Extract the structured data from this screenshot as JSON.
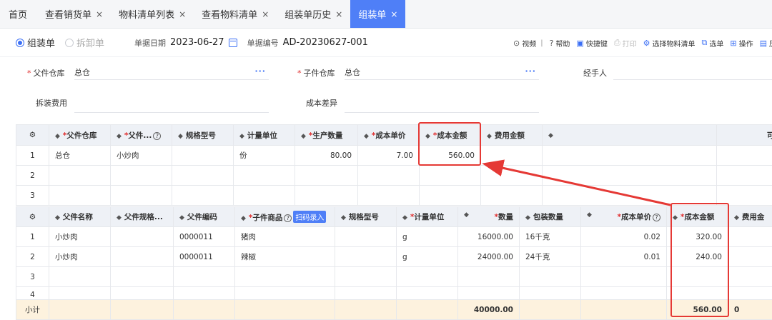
{
  "tabs": [
    {
      "label": "首页",
      "closable": false,
      "active": false
    },
    {
      "label": "查看销货单",
      "closable": true,
      "active": false
    },
    {
      "label": "物料清单列表",
      "closable": true,
      "active": false
    },
    {
      "label": "查看物料清单",
      "closable": true,
      "active": false
    },
    {
      "label": "组装单历史",
      "closable": true,
      "active": false
    },
    {
      "label": "组装单",
      "closable": true,
      "active": true
    }
  ],
  "close_glyph": "×",
  "mode": {
    "assemble": "组装单",
    "disassemble": "拆卸单",
    "selected": "组装单"
  },
  "doc": {
    "date_label": "单据日期",
    "date": "2023-06-27",
    "no_label": "单据编号",
    "no": "AD-20230627-001"
  },
  "actions": {
    "video": "视频",
    "help": "帮助",
    "shortcut": "快捷键",
    "print": "打印",
    "select_bom": "选择物料清单",
    "select": "选单",
    "operate": "操作",
    "last": "历"
  },
  "form": {
    "parent_wh_label": "父件仓库",
    "parent_wh": "总仓",
    "child_wh_label": "子件仓库",
    "child_wh": "总仓",
    "handler_label": "经手人",
    "handler": "",
    "cost_label": "拆装费用",
    "cost": "",
    "diff_label": "成本差异",
    "diff": "",
    "more": "···"
  },
  "table1": {
    "headers": {
      "c1": "父件仓库",
      "c2": "父件...",
      "c3": "规格型号",
      "c4": "计量单位",
      "c5": "生产数量",
      "c6": "成本单价",
      "c7": "成本金额",
      "c8": "费用金额",
      "c9": "",
      "c10": "可用"
    },
    "rows": [
      {
        "idx": "1",
        "wh": "总仓",
        "item": "小炒肉",
        "spec": "",
        "unit": "份",
        "qty": "80.00",
        "price": "7.00",
        "amount": "560.00",
        "fee": ""
      },
      {
        "idx": "2",
        "wh": "",
        "item": "",
        "spec": "",
        "unit": "",
        "qty": "",
        "price": "",
        "amount": "",
        "fee": ""
      },
      {
        "idx": "3",
        "wh": "",
        "item": "",
        "spec": "",
        "unit": "",
        "qty": "",
        "price": "",
        "amount": "",
        "fee": ""
      }
    ]
  },
  "table2": {
    "headers": {
      "c1": "父件名称",
      "c2": "父件规格...",
      "c3": "父件编码",
      "c4": "子件商品",
      "scan": "扫码录入",
      "c5": "规格型号",
      "c6": "计量单位",
      "c7": "数量",
      "c8": "包装数量",
      "c9": "成本单价",
      "c10": "成本金额",
      "c11": "费用金"
    },
    "rows": [
      {
        "idx": "1",
        "pname": "小炒肉",
        "pspec": "",
        "pcode": "0000011",
        "child": "猪肉",
        "spec": "",
        "unit": "g",
        "qty": "16000.00",
        "pack": "16千克",
        "price": "0.02",
        "amount": "320.00"
      },
      {
        "idx": "2",
        "pname": "小炒肉",
        "pspec": "",
        "pcode": "0000011",
        "child": "辣椒",
        "spec": "",
        "unit": "g",
        "qty": "24000.00",
        "pack": "24千克",
        "price": "0.01",
        "amount": "240.00"
      },
      {
        "idx": "3",
        "pname": "",
        "pspec": "",
        "pcode": "",
        "child": "",
        "spec": "",
        "unit": "",
        "qty": "",
        "pack": "",
        "price": "",
        "amount": ""
      },
      {
        "idx": "4",
        "pname": "",
        "pspec": "",
        "pcode": "",
        "child": "",
        "spec": "",
        "unit": "",
        "qty": "",
        "pack": "",
        "price": "",
        "amount": ""
      }
    ],
    "subtotal": {
      "label": "小计",
      "qty": "40000.00",
      "amount": "560.00",
      "tail": "0"
    }
  },
  "colors": {
    "accent": "#4f7ff7",
    "highlight": "#e53935",
    "subtotal_bg": "#fdf2de"
  }
}
